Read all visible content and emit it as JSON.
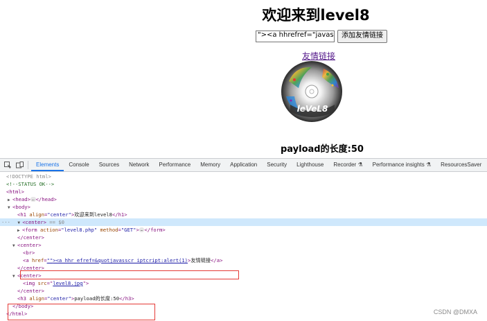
{
  "page": {
    "title": "欢迎来到level8",
    "keyword_value": "\"><a hhrefref=\"javascripto",
    "submit_label": "添加友情链接",
    "friend_link": "友情链接",
    "payload_length": "payload的长度:50"
  },
  "devtools": {
    "tabs": [
      "Elements",
      "Console",
      "Sources",
      "Network",
      "Performance",
      "Memory",
      "Application",
      "Security",
      "Lighthouse",
      "Recorder ⚗",
      "Performance insights ⚗",
      "ResourcesSaver"
    ],
    "active_tab": "Elements",
    "dom": {
      "doctype": "<!DOCTYPE html>",
      "comment": "<!--STATUS OK-->",
      "html_open": "<html>",
      "head": {
        "open": "<head>",
        "close": "</head>"
      },
      "body_open": "<body>",
      "h1": {
        "open": "<h1 ",
        "attr": "align",
        "val": "\"center\"",
        "text": "欢迎来到level8",
        "close": "</h1>"
      },
      "center1": {
        "open": "<center>",
        "sel_marker": "== $0"
      },
      "form": {
        "open": "<form ",
        "attr1": "action",
        "val1": "\"level8.php\"",
        "attr2": "method",
        "val2": "\"GET\"",
        "close": "</form>"
      },
      "center_close": "</center>",
      "center2_open": "<center>",
      "br": "<br>",
      "a": {
        "open": "<a ",
        "attr": "href",
        "val": "\"\"",
        "inner": "><a hhr efref=&quotjavasscr iptcript:alert(1)",
        "text": "友情链接",
        "close": "</a>"
      },
      "center3_open": "<center>",
      "img": {
        "open": "<img ",
        "attr": "src",
        "val": "level8.jpg"
      },
      "h3": {
        "open": "<h3 ",
        "attr": "align",
        "val": "\"center\"",
        "text": "payload的长度:50",
        "close": "</h3>"
      },
      "body_close": "</body>",
      "html_close": "</html>"
    }
  },
  "watermark": "CSDN @DMXA"
}
